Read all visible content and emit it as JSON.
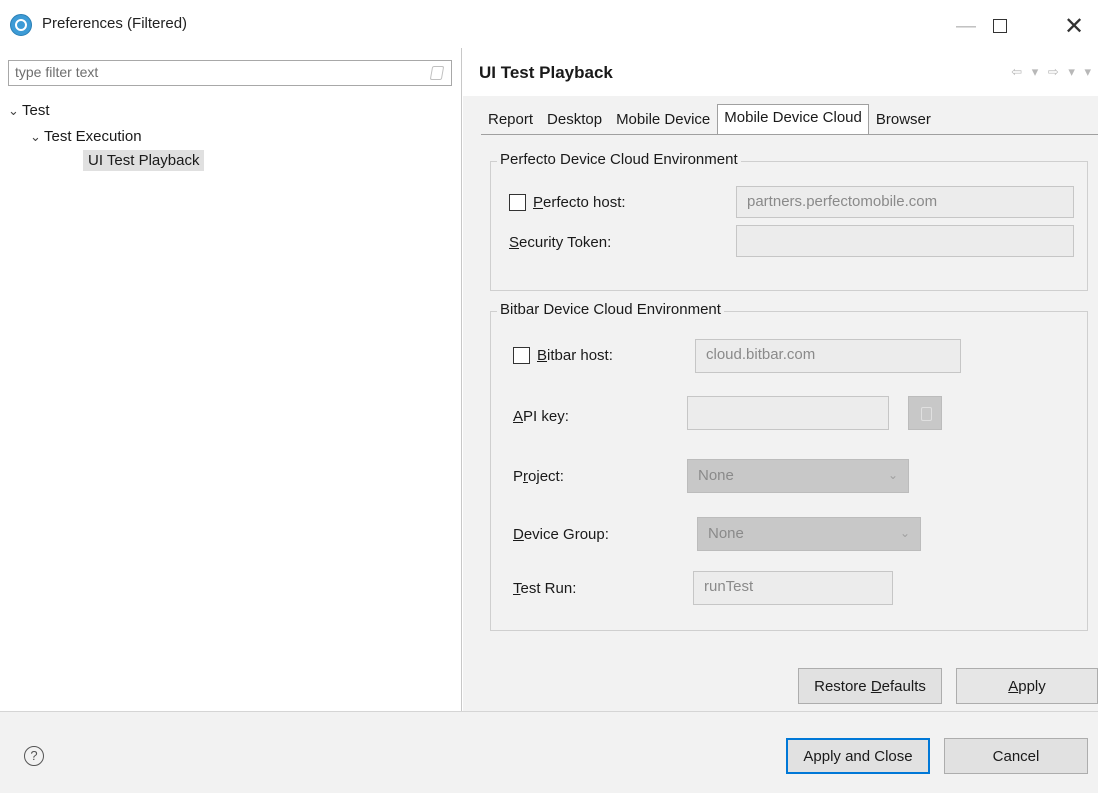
{
  "window": {
    "title": "Preferences (Filtered)",
    "minimize_glyph": "—",
    "close_glyph": "✕"
  },
  "filter": {
    "placeholder": "type filter text"
  },
  "tree": {
    "items": [
      {
        "label": "Test",
        "expanded": true,
        "level": 0
      },
      {
        "label": "Test Execution",
        "expanded": true,
        "level": 1
      },
      {
        "label": "UI Test Playback",
        "selected": true,
        "level": 2
      }
    ],
    "caret_glyph": "⌄"
  },
  "page": {
    "title": "UI Test Playback",
    "nav_glyphs": "⇦ ▾ ⇨ ▾ ▾"
  },
  "tabs": [
    {
      "label": "Report",
      "active": false
    },
    {
      "label": "Desktop",
      "active": false
    },
    {
      "label": "Mobile Device",
      "active": false
    },
    {
      "label": "Mobile Device Cloud",
      "active": true
    },
    {
      "label": "Browser",
      "active": false
    }
  ],
  "perfecto": {
    "group_title": "Perfecto Device Cloud Environment",
    "host_mnemonic": "P",
    "host_rest": "erfecto host:",
    "host_checked": false,
    "host_value": "partners.perfectomobile.com",
    "token_mnemonic": "S",
    "token_rest": "ecurity Token:",
    "token_value": ""
  },
  "bitbar": {
    "group_title": "Bitbar Device Cloud Environment",
    "host_mnemonic": "B",
    "host_rest": "itbar host:",
    "host_checked": false,
    "host_value": "cloud.bitbar.com",
    "apikey_mnemonic": "A",
    "apikey_rest": "PI key:",
    "apikey_value": "",
    "project_pre": "P",
    "project_mnemonic": "r",
    "project_rest": "oject:",
    "project_value": "None",
    "group_mnemonic": "D",
    "group_rest": "evice Group:",
    "group_value": "None",
    "testrun_mnemonic": "T",
    "testrun_rest": "est Run:",
    "testrun_value": "runTest",
    "combo_chevron": "⌄"
  },
  "buttons": {
    "restore_pre": "Restore ",
    "restore_mnemonic": "D",
    "restore_rest": "efaults",
    "apply_mnemonic": "A",
    "apply_rest": "pply",
    "apply_close": "Apply and Close",
    "cancel": "Cancel",
    "help_glyph": "?"
  }
}
